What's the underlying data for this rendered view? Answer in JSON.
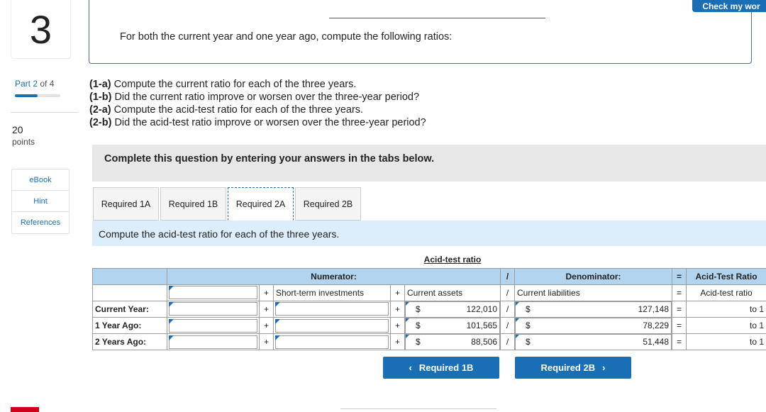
{
  "question": {
    "number": "3",
    "part_label": "Part 2",
    "part_of": "of 4",
    "part_progress": 0.5,
    "points": "20",
    "points_label": "points"
  },
  "sidebar": {
    "items": [
      {
        "label": "eBook"
      },
      {
        "label": "Hint"
      },
      {
        "label": "References"
      }
    ]
  },
  "header": {
    "check_button": "Check my wor",
    "intro": "For both the current year and one year ago, compute the following ratios:"
  },
  "instructions": [
    {
      "tag": "(1-a)",
      "text": " Compute the current ratio for each of the three years."
    },
    {
      "tag": "(1-b)",
      "text": " Did the current ratio improve or worsen over the three-year period?"
    },
    {
      "tag": "(2-a)",
      "text": " Compute the acid-test ratio for each of the three years."
    },
    {
      "tag": "(2-b)",
      "text": " Did the acid-test ratio improve or worsen over the three-year period?"
    }
  ],
  "panel": {
    "text": "Complete this question by entering your answers in the tabs below."
  },
  "tabs": [
    {
      "label": "Required 1A",
      "active": false
    },
    {
      "label": "Required 1B",
      "active": false
    },
    {
      "label": "Required 2A",
      "active": true
    },
    {
      "label": "Required 2B",
      "active": false
    }
  ],
  "content": {
    "prompt": "Compute the acid-test ratio for each of the three years.",
    "table": {
      "title": "Acid-test ratio",
      "numerator_label": "Numerator:",
      "slash": "/",
      "denominator_label": "Denominator:",
      "equals": "=",
      "result_label": "Acid-Test Ratio",
      "col_short_term": "Short-term investments",
      "col_current_assets": "Current assets",
      "col_current_liabilities": "Current liabilities",
      "col_result": "Acid-test ratio",
      "plus": "+",
      "dollar": "$",
      "to_one": "to 1",
      "rows": [
        {
          "label": "Current Year:",
          "current_assets": "122,010",
          "current_liabilities": "127,148"
        },
        {
          "label": "1 Year Ago:",
          "current_assets": "101,565",
          "current_liabilities": "78,229"
        },
        {
          "label": "2 Years Ago:",
          "current_assets": "88,506",
          "current_liabilities": "51,448"
        }
      ]
    }
  },
  "nav": {
    "prev_label": "Required 1B",
    "next_label": "Required 2B",
    "prev_icon": "chevron-left-icon",
    "next_icon": "chevron-right-icon"
  },
  "colors": {
    "accent": "#1a6fb4",
    "header_row": "#b2d4ef",
    "content_strip": "#dceefb",
    "panel": "#e7e7e7"
  }
}
